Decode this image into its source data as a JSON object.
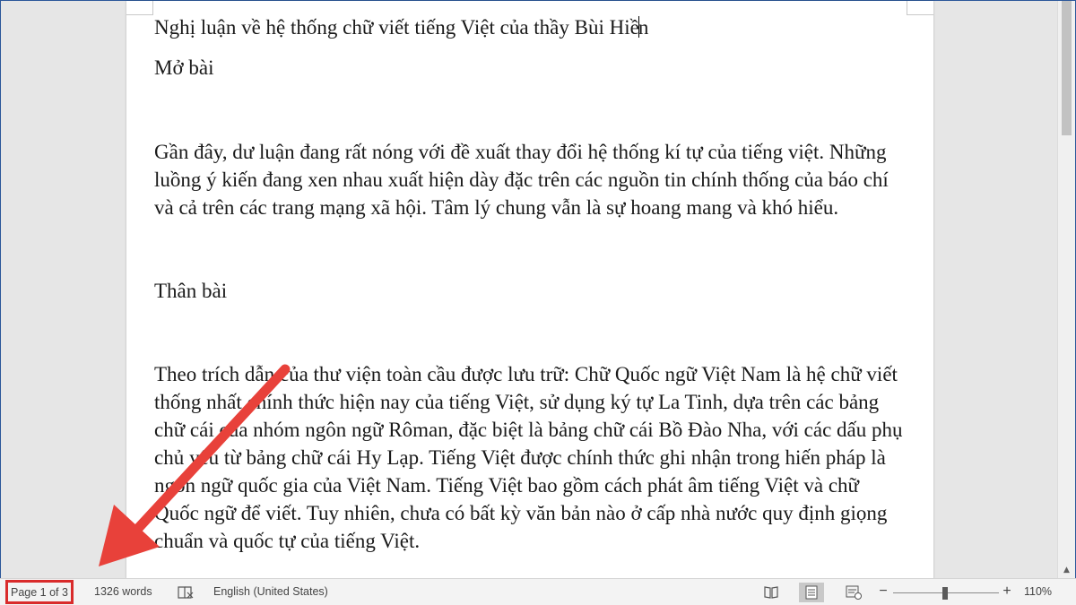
{
  "document": {
    "title": "Nghị luận về hệ thống chữ viết tiếng Việt của thầy Bùi Hiền",
    "title_before_caret": "Nghị luận về hệ thống chữ viết tiếng Việt của thầy Bùi Hiề",
    "title_after_caret": "n",
    "heading_intro": "Mở bài",
    "intro_paragraph": "Gần đây, dư luận đang rất nóng với đề xuất thay đổi hệ thống kí tự của tiếng việt. Những luồng ý kiến đang xen nhau xuất hiện dày đặc trên các nguồn tin chính thống của báo chí và cả trên các trang mạng xã hội. Tâm lý chung vẫn là sự hoang mang và khó hiểu.",
    "heading_body": "Thân bài",
    "body_paragraph": "Theo trích dẫn của thư viện toàn cầu được lưu trữ: Chữ Quốc ngữ Việt Nam là hệ chữ viết thống nhất chính thức hiện nay của tiếng Việt, sử dụng ký tự La Tinh, dựa trên các bảng chữ cái của nhóm ngôn ngữ Rôman, đặc biệt là bảng chữ cái Bồ Đào Nha, với các dấu phụ chủ yếu từ bảng chữ cái Hy Lạp. Tiếng Việt được chính thức ghi nhận trong hiến pháp là ngôn ngữ quốc gia của Việt Nam. Tiếng Việt bao gồm cách phát âm tiếng Việt và chữ Quốc ngữ để viết. Tuy nhiên, chưa có bất kỳ văn bản nào ở cấp nhà nước quy định giọng chuẩn và quốc tự của tiếng Việt."
  },
  "statusbar": {
    "page_count": "Page 1 of 3",
    "word_count": "1326 words",
    "language": "English (United States)",
    "zoom_minus": "−",
    "zoom_plus": "+",
    "zoom_level": "110%",
    "zoom_percent": 110,
    "active_view": "print-layout",
    "proofing_icon": "proofing-book-icon"
  },
  "annotation": {
    "arrow_color": "#e8413a",
    "highlight_color": "#d92b2b",
    "target": "page-count"
  }
}
